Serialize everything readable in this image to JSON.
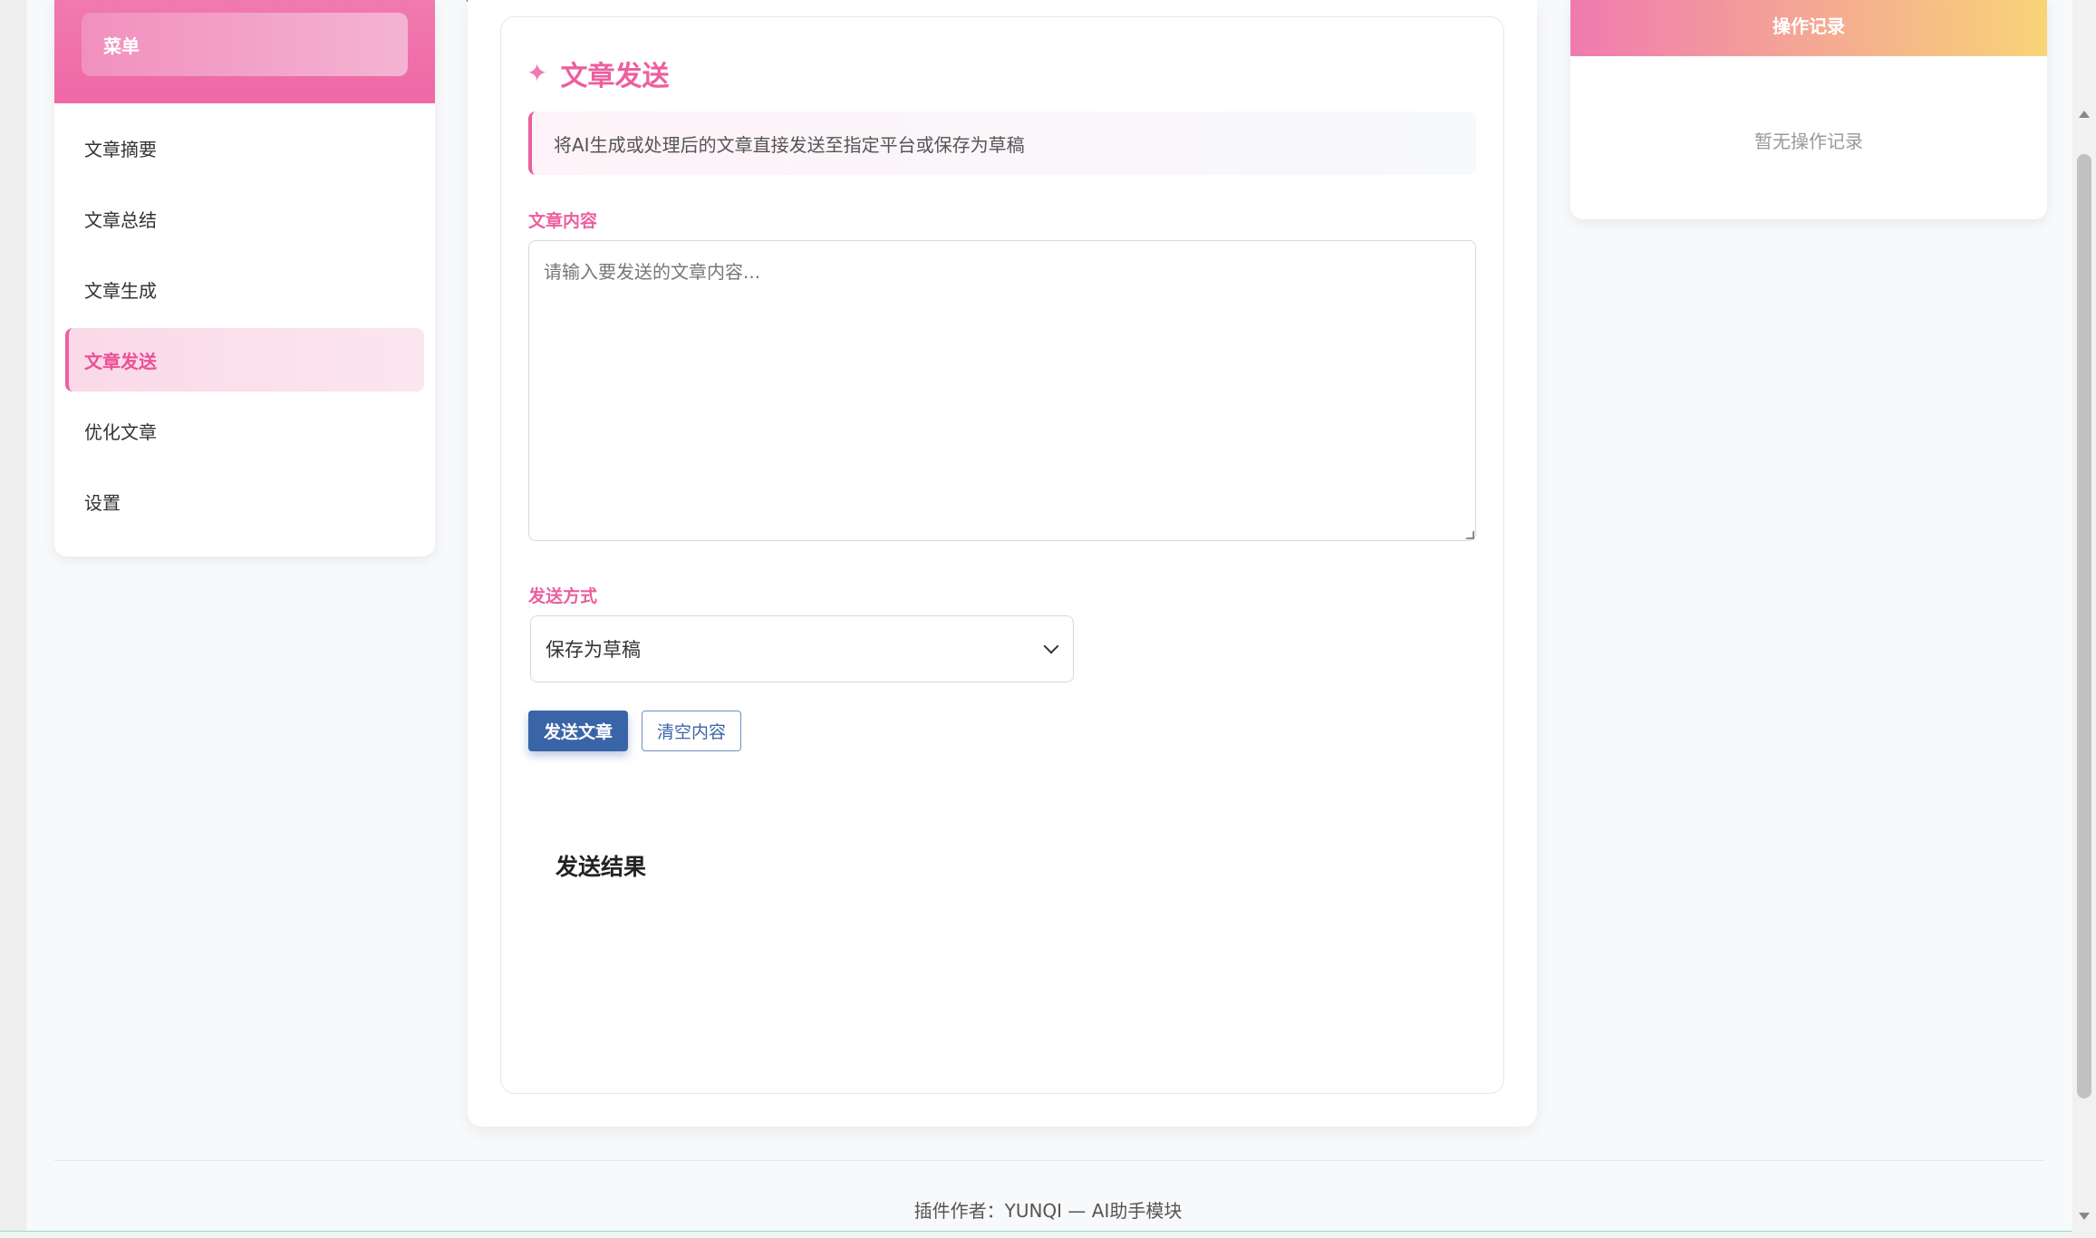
{
  "sidebar": {
    "menu_title": "菜单",
    "items": [
      {
        "label": "文章摘要"
      },
      {
        "label": "文章总结"
      },
      {
        "label": "文章生成"
      },
      {
        "label": "文章发送"
      },
      {
        "label": "优化文章"
      },
      {
        "label": "设置"
      }
    ],
    "active_item": "文章发送"
  },
  "main": {
    "icon": "sparkle-icon",
    "title": "文章发送",
    "notice": "将AI生成或处理后的文章直接发送至指定平台或保存为草稿",
    "content_label": "文章内容",
    "content_value": "",
    "content_placeholder": "请输入要发送的文章内容...",
    "method_label": "发送方式",
    "method_selected": "保存为草稿",
    "send_button": "发送文章",
    "clear_button": "清空内容",
    "result_title": "发送结果"
  },
  "right_panel": {
    "title": "操作记录",
    "empty_text": "暂无操作记录"
  },
  "footer": {
    "text": "插件作者：YUNQI — AI助手模块"
  },
  "colors": {
    "accent_pink": "#ec5f9f",
    "button_blue": "#3a64a8",
    "gradient_yellow": "#f8d477"
  }
}
